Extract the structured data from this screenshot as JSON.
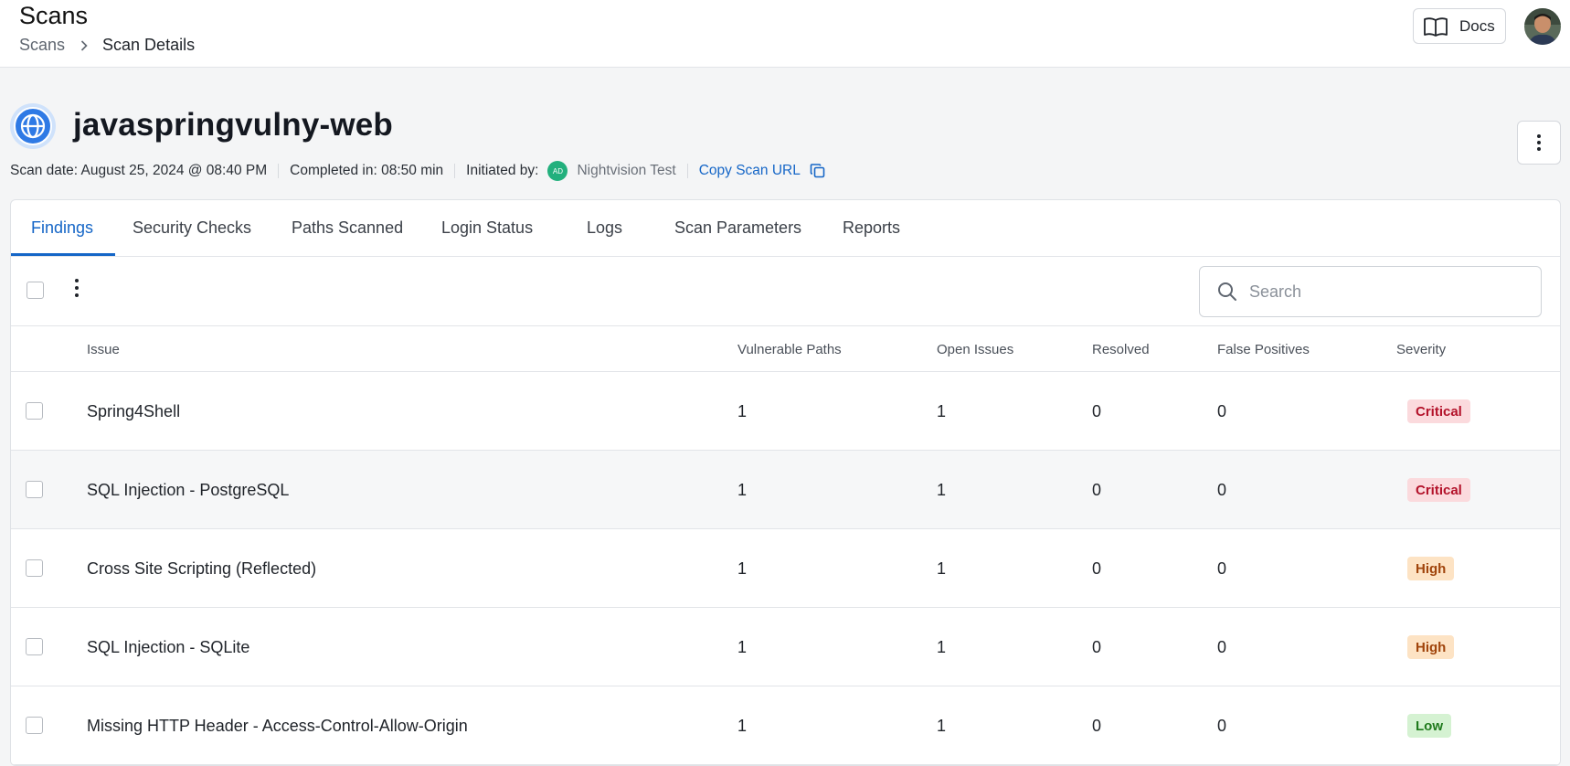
{
  "header": {
    "title": "Scans",
    "breadcrumb": {
      "parent": "Scans",
      "current": "Scan Details"
    },
    "docs_label": "Docs"
  },
  "scan": {
    "name": "javaspringvulny-web",
    "scan_date": "Scan date: August 25, 2024 @ 08:40 PM",
    "completed_in": "Completed in: 08:50 min",
    "initiated_by_label": "Initiated by:",
    "initiator_initials": "AD",
    "initiator_name": "Nightvision Test",
    "copy_url_label": "Copy Scan URL"
  },
  "tabs": [
    {
      "label": "Findings",
      "active": true
    },
    {
      "label": "Security Checks",
      "active": false
    },
    {
      "label": "Paths Scanned",
      "active": false
    },
    {
      "label": "Login Status",
      "active": false
    },
    {
      "label": "Logs",
      "active": false
    },
    {
      "label": "Scan Parameters",
      "active": false
    },
    {
      "label": "Reports",
      "active": false
    }
  ],
  "search": {
    "placeholder": "Search"
  },
  "table": {
    "columns": [
      "Issue",
      "Vulnerable Paths",
      "Open Issues",
      "Resolved",
      "False Positives",
      "Severity"
    ],
    "rows": [
      {
        "issue": "Spring4Shell",
        "vulnerable_paths": "1",
        "open_issues": "1",
        "resolved": "0",
        "false_positives": "0",
        "severity": "Critical"
      },
      {
        "issue": "SQL Injection - PostgreSQL",
        "vulnerable_paths": "1",
        "open_issues": "1",
        "resolved": "0",
        "false_positives": "0",
        "severity": "Critical"
      },
      {
        "issue": "Cross Site Scripting (Reflected)",
        "vulnerable_paths": "1",
        "open_issues": "1",
        "resolved": "0",
        "false_positives": "0",
        "severity": "High"
      },
      {
        "issue": "SQL Injection - SQLite",
        "vulnerable_paths": "1",
        "open_issues": "1",
        "resolved": "0",
        "false_positives": "0",
        "severity": "High"
      },
      {
        "issue": "Missing HTTP Header - Access-Control-Allow-Origin",
        "vulnerable_paths": "1",
        "open_issues": "1",
        "resolved": "0",
        "false_positives": "0",
        "severity": "Low"
      }
    ]
  },
  "severity_colors": {
    "Critical": {
      "bg": "#fbdadd",
      "fg": "#b3122a"
    },
    "High": {
      "bg": "#fde3c4",
      "fg": "#a0440b"
    },
    "Low": {
      "bg": "#d5f2d2",
      "fg": "#1f7a1c"
    }
  },
  "accent_color": "#1566c7",
  "icons": [
    "chevron-right-icon",
    "book-icon",
    "globe-icon",
    "vertical-dots-icon",
    "copy-icon",
    "search-icon"
  ]
}
